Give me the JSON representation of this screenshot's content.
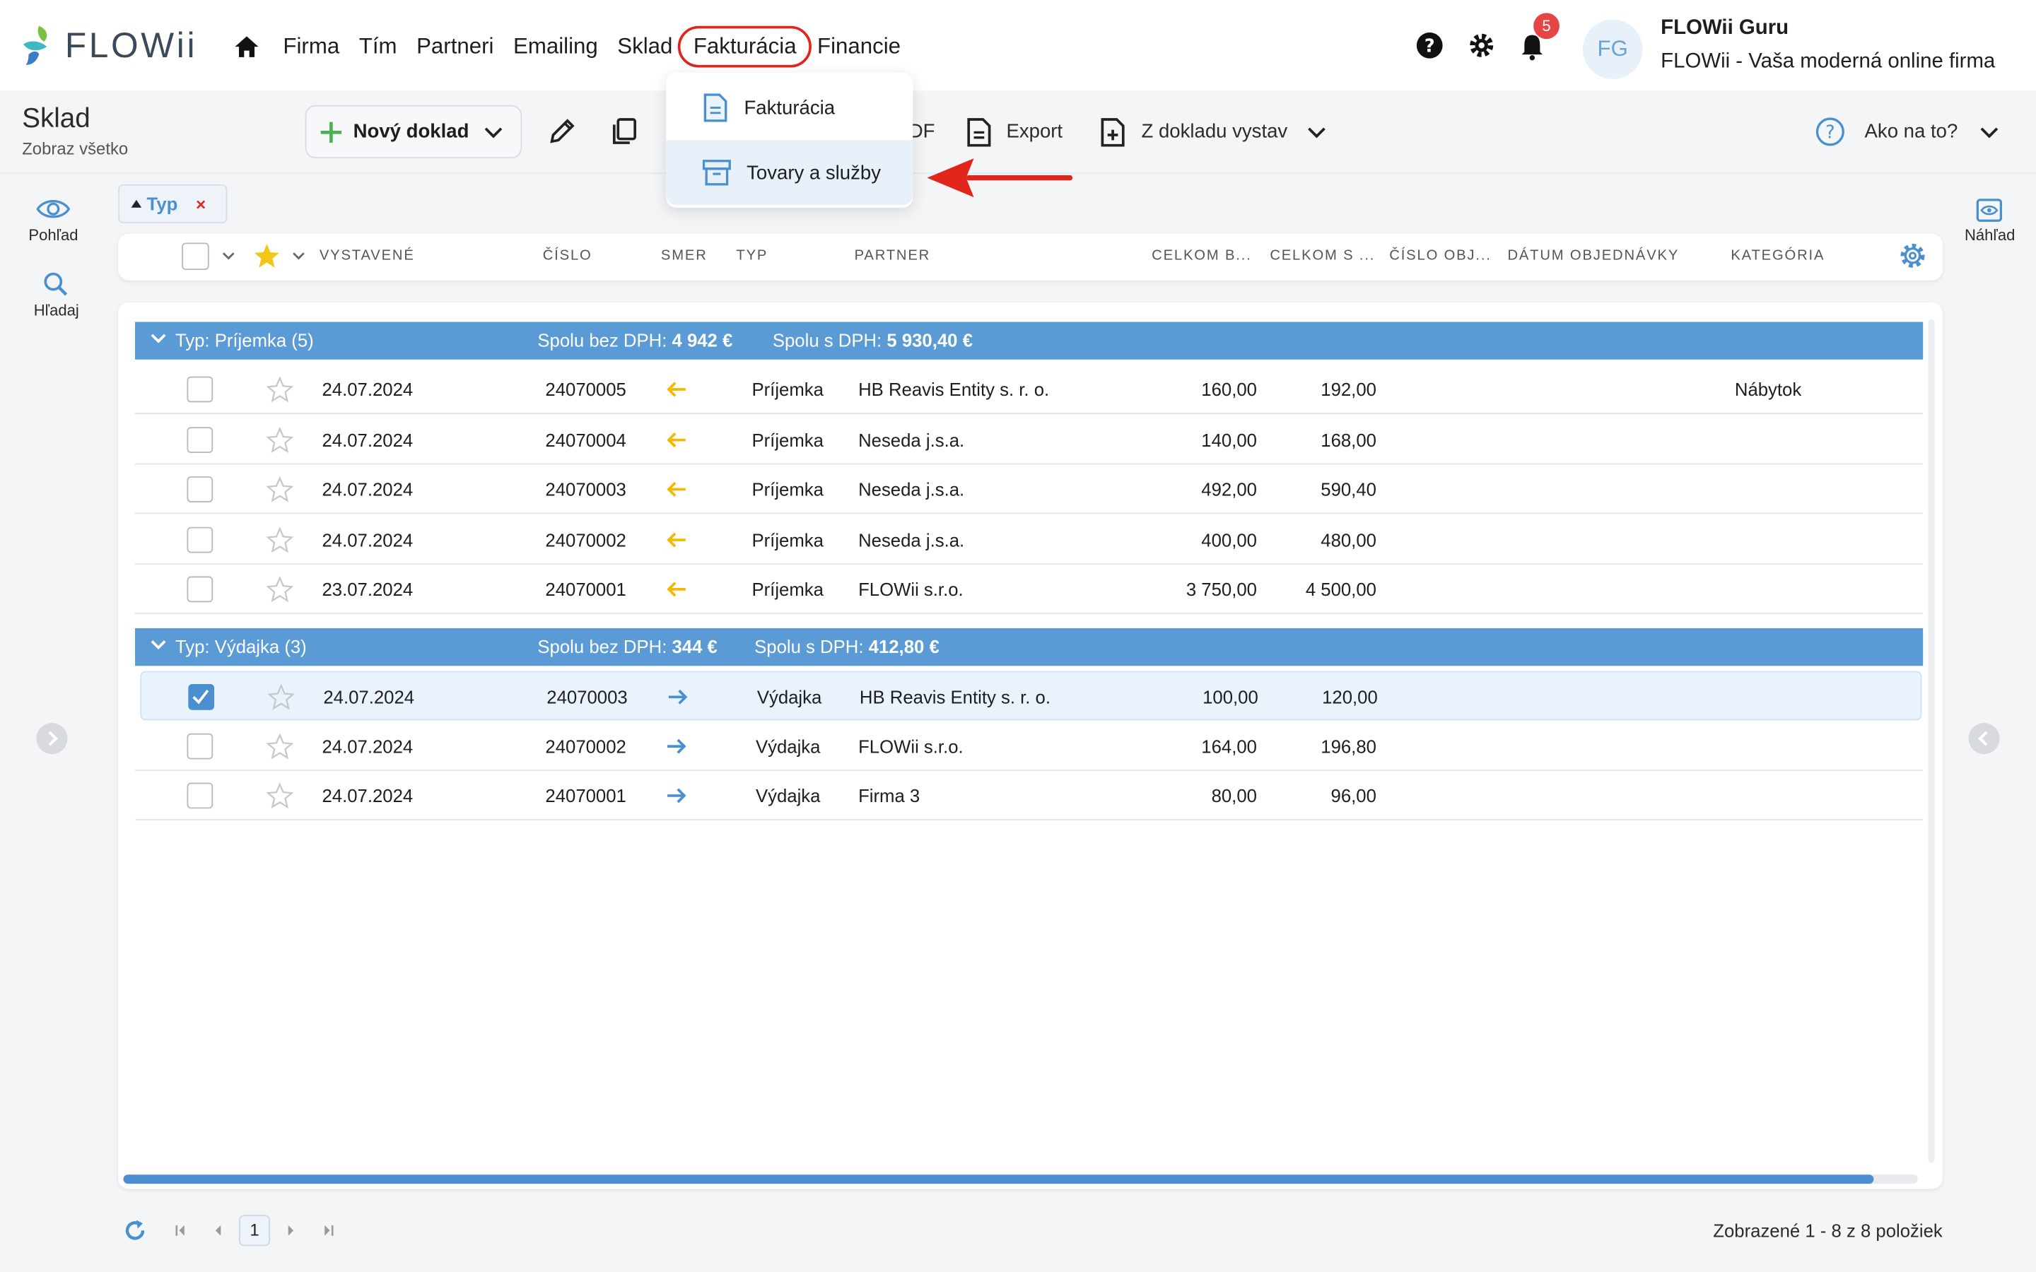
{
  "app": {
    "logo_text": "FLOWii",
    "brand_colors": {
      "accent": "#4a8fd0",
      "group": "#5b9bd5",
      "highlight": "#e0261b",
      "star": "#f5c518",
      "incoming": "#f5b800"
    }
  },
  "nav": {
    "items": [
      {
        "label": "Firma"
      },
      {
        "label": "Tím"
      },
      {
        "label": "Partneri"
      },
      {
        "label": "Emailing"
      },
      {
        "label": "Sklad"
      },
      {
        "label": "Fakturácia"
      },
      {
        "label": "Financie"
      }
    ]
  },
  "user": {
    "notifications": "5",
    "initials": "FG",
    "name": "FLOWii Guru",
    "company": "FLOWii - Vaša moderná online firma"
  },
  "page": {
    "title": "Sklad",
    "subtitle": "Zobraz všetko"
  },
  "toolbar": {
    "new_doc": "Nový doklad",
    "pdf_partial": "DF",
    "export": "Export",
    "create_from": "Z dokladu vystav",
    "help": "Ako na to?"
  },
  "dropdown": {
    "items": [
      {
        "label": "Fakturácia",
        "icon": "document-icon"
      },
      {
        "label": "Tovary a služby",
        "icon": "archive-box-icon"
      }
    ]
  },
  "side": {
    "view": "Pohľad",
    "search": "Hľadaj",
    "preview": "Náhľad"
  },
  "filter": {
    "chip": "Typ",
    "remove": "×"
  },
  "columns": {
    "issued": "VYSTAVENÉ",
    "number": "ČÍSLO",
    "direction": "SMER",
    "type": "TYP",
    "partner": "PARTNER",
    "total_net": "CELKOM B...",
    "total_gross": "CELKOM S ...",
    "order_no": "ČÍSLO OBJ...",
    "order_date": "DÁTUM OBJEDNÁVKY",
    "category": "KATEGÓRIA"
  },
  "groups": [
    {
      "title": "Typ: Príjemka (5)",
      "net_label": "Spolu bez DPH:",
      "net_value": "4 942 €",
      "gross_label": "Spolu s DPH:",
      "gross_value": "5 930,40 €",
      "rows": [
        {
          "date": "24.07.2024",
          "number": "24070005",
          "direction": "in",
          "type": "Príjemka",
          "partner": "HB Reavis Entity s. r. o.",
          "net": "160,00",
          "gross": "192,00",
          "category": "Nábytok",
          "checked": false
        },
        {
          "date": "24.07.2024",
          "number": "24070004",
          "direction": "in",
          "type": "Príjemka",
          "partner": "Neseda j.s.a.",
          "net": "140,00",
          "gross": "168,00",
          "category": "",
          "checked": false
        },
        {
          "date": "24.07.2024",
          "number": "24070003",
          "direction": "in",
          "type": "Príjemka",
          "partner": "Neseda j.s.a.",
          "net": "492,00",
          "gross": "590,40",
          "category": "",
          "checked": false
        },
        {
          "date": "24.07.2024",
          "number": "24070002",
          "direction": "in",
          "type": "Príjemka",
          "partner": "Neseda j.s.a.",
          "net": "400,00",
          "gross": "480,00",
          "category": "",
          "checked": false
        },
        {
          "date": "23.07.2024",
          "number": "24070001",
          "direction": "in",
          "type": "Príjemka",
          "partner": "FLOWii s.r.o.",
          "net": "3 750,00",
          "gross": "4 500,00",
          "category": "",
          "checked": false
        }
      ]
    },
    {
      "title": "Typ: Výdajka (3)",
      "net_label": "Spolu bez DPH:",
      "net_value": "344 €",
      "gross_label": "Spolu s DPH:",
      "gross_value": "412,80 €",
      "rows": [
        {
          "date": "24.07.2024",
          "number": "24070003",
          "direction": "out",
          "type": "Výdajka",
          "partner": "HB Reavis Entity s. r. o.",
          "net": "100,00",
          "gross": "120,00",
          "category": "",
          "checked": true
        },
        {
          "date": "24.07.2024",
          "number": "24070002",
          "direction": "out",
          "type": "Výdajka",
          "partner": "FLOWii s.r.o.",
          "net": "164,00",
          "gross": "196,80",
          "category": "",
          "checked": false
        },
        {
          "date": "24.07.2024",
          "number": "24070001",
          "direction": "out",
          "type": "Výdajka",
          "partner": "Firma 3",
          "net": "80,00",
          "gross": "96,00",
          "category": "",
          "checked": false
        }
      ]
    }
  ],
  "pager": {
    "page": "1",
    "info": "Zobrazené 1 - 8 z 8 položiek"
  }
}
